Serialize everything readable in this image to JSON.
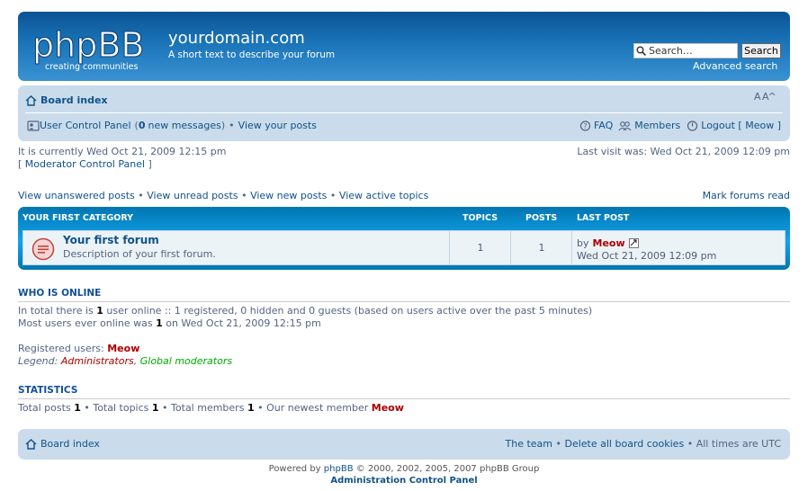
{
  "header": {
    "logo_text": "phpBB",
    "logo_tagline": "creating communities",
    "site_title": "yourdomain.com",
    "site_description": "A short text to describe your forum",
    "search_placeholder": "Search…",
    "search_button": "Search",
    "advanced_search": "Advanced search"
  },
  "navbar": {
    "board_index": "Board index",
    "font_size": "A A",
    "ucp": "User Control Panel",
    "ucp_open": "(",
    "new_messages_count": "0",
    "new_messages_label": "new messages",
    "ucp_close": ")",
    "bullet": "•",
    "view_posts": "View your posts",
    "faq": "FAQ",
    "members": "Members",
    "logout": "Logout [ Meow ]"
  },
  "info": {
    "current_time": "It is currently Wed Oct 21, 2009 12:15 pm",
    "mcp_open": "[",
    "mcp": "Moderator Control Panel",
    "mcp_close": "]",
    "last_visit": "Last visit was: Wed Oct 21, 2009 12:09 pm",
    "quick_links": [
      "View unanswered posts",
      "View unread posts",
      "View new posts",
      "View active topics"
    ],
    "mark_read": "Mark forums read"
  },
  "forum_list": {
    "category": "Your first category",
    "col_topics": "Topics",
    "col_posts": "Posts",
    "col_lastpost": "Last post",
    "forums": [
      {
        "name": "Your first forum",
        "description": "Description of your first forum.",
        "topics": "1",
        "posts": "1",
        "lastpost_by": "by",
        "lastpost_user": "Meow",
        "lastpost_date": "Wed Oct 21, 2009 12:09 pm"
      }
    ]
  },
  "online": {
    "title": "Who is online",
    "total_pre": "In total there is",
    "total_count": "1",
    "total_post": "user online :: 1 registered, 0 hidden and 0 guests (based on users active over the past 5 minutes)",
    "most_pre": "Most users ever online was",
    "most_count": "1",
    "most_post": "on Wed Oct 21, 2009 12:15 pm",
    "registered_label": "Registered users:",
    "registered_user": "Meow",
    "legend_label": "Legend:",
    "legend_admins": "Administrators",
    "legend_sep": ",",
    "legend_gm": "Global moderators"
  },
  "stats": {
    "title": "Statistics",
    "posts_label": "Total posts",
    "posts": "1",
    "topics_label": "Total topics",
    "topics": "1",
    "members_label": "Total members",
    "members": "1",
    "newest_label": "Our newest member",
    "newest": "Meow",
    "bullet": "•"
  },
  "footer": {
    "board_index": "Board index",
    "team": "The team",
    "bullet": "•",
    "delete_cookies": "Delete all board cookies",
    "timezone": "All times are UTC",
    "powered_pre": "Powered by",
    "powered_link": "phpBB",
    "powered_post": "© 2000, 2002, 2005, 2007 phpBB Group",
    "acp": "Administration Control Panel"
  },
  "colors": {
    "header_blue": "#0b5394",
    "nav_bg": "#cadceb",
    "link": "#105289",
    "admin": "#aa0000",
    "global_mod": "#00aa00"
  }
}
